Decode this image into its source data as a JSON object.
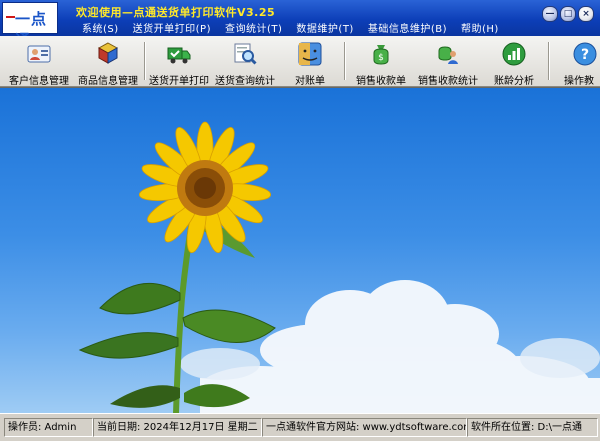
{
  "app": {
    "logo_text": "一点通",
    "title": "欢迎使用—点通送货单打印软件V3.25"
  },
  "menu": [
    {
      "label": "系统(S)"
    },
    {
      "label": "送货开单打印(P)"
    },
    {
      "label": "查询统计(T)"
    },
    {
      "label": "数据维护(T)"
    },
    {
      "label": "基础信息维护(B)"
    },
    {
      "label": "帮助(H)"
    }
  ],
  "window_controls": {
    "minimize": "—",
    "restore": "□",
    "close": "×"
  },
  "toolbar": [
    {
      "label": "客户信息管理",
      "icon": "customer-card-icon"
    },
    {
      "label": "商品信息管理",
      "icon": "product-boxes-icon"
    },
    {
      "label": "送货开单打印",
      "icon": "delivery-truck-icon"
    },
    {
      "label": "送货查询统计",
      "icon": "search-magnifier-icon"
    },
    {
      "label": "对账单",
      "icon": "finder-face-icon"
    },
    {
      "label": "销售收款单",
      "icon": "money-bag-icon"
    },
    {
      "label": "销售收款统计",
      "icon": "money-people-icon"
    },
    {
      "label": "账龄分析",
      "icon": "bar-chart-icon"
    },
    {
      "label": "操作教",
      "icon": "help-question-icon"
    }
  ],
  "status": {
    "operator": "操作员: Admin",
    "date": "当前日期: 2024年12月17日  星期二",
    "website": "一点通软件官方网站: www.ydtsoftware.com",
    "location": "软件所在位置: D:\\一点通"
  },
  "colors": {
    "titlebar": "#0d3fb8",
    "title_text": "#ffe92a",
    "sky": "#3c8ee6",
    "petal": "#f5c800"
  }
}
